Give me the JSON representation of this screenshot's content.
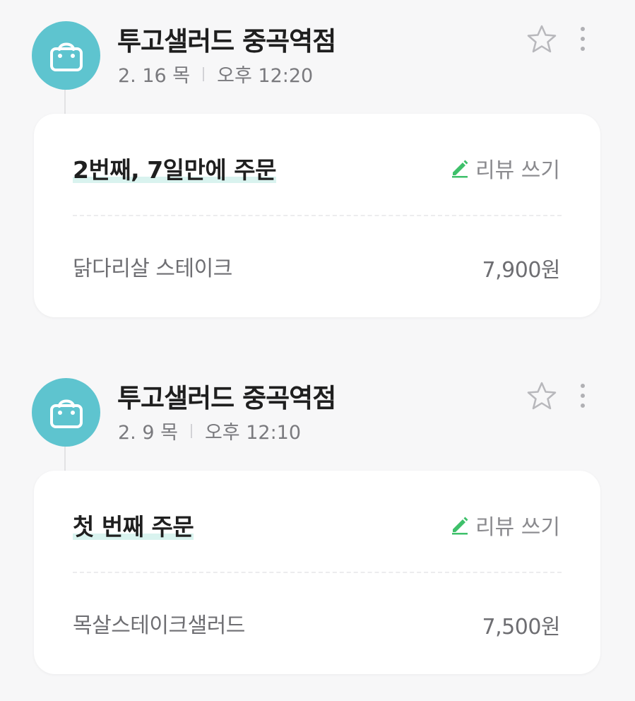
{
  "orders": [
    {
      "store_name": "투고샐러드 중곡역점",
      "date": "2. 16 목",
      "time": "오후 12:20",
      "order_count_label": "2번째, 7일만에 주문",
      "review_label": "리뷰 쓰기",
      "item_name": "닭다리살 스테이크",
      "item_price": "7,900원"
    },
    {
      "store_name": "투고샐러드 중곡역점",
      "date": "2. 9 목",
      "time": "오후 12:10",
      "order_count_label": "첫 번째 주문",
      "review_label": "리뷰 쓰기",
      "item_name": "목살스테이크샐러드",
      "item_price": "7,500원"
    }
  ],
  "icons": {
    "store": "shopping-bag-icon",
    "favorite": "star-outline-icon",
    "more": "more-vertical-icon",
    "review": "pencil-icon"
  },
  "colors": {
    "store_icon_bg": "#5ec4cf",
    "review_icon": "#3ec06a",
    "highlight": "#d9f3ef"
  }
}
